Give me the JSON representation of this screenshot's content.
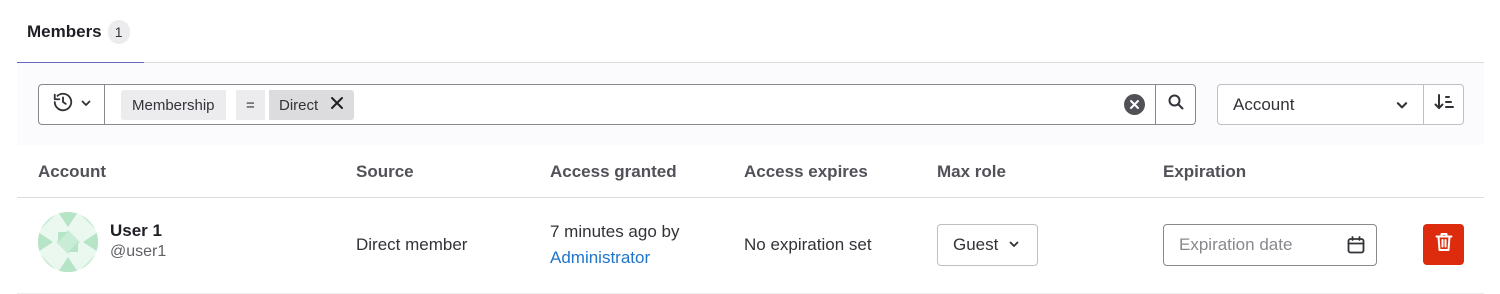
{
  "tabs": [
    {
      "label": "Members",
      "count": "1"
    }
  ],
  "filter": {
    "token_key": "Membership",
    "token_operator": "=",
    "token_value": "Direct"
  },
  "sort": {
    "selected": "Account"
  },
  "table": {
    "headers": [
      "Account",
      "Source",
      "Access granted",
      "Access expires",
      "Max role",
      "Expiration"
    ],
    "rows": [
      {
        "name": "User 1",
        "username": "@user1",
        "source": "Direct member",
        "granted_time": "7 minutes ago by",
        "granted_by": "Administrator",
        "expires": "No expiration set",
        "role": "Guest",
        "expiration_placeholder": "Expiration date"
      }
    ]
  },
  "colors": {
    "accent": "#6666c4",
    "link": "#1f75cb",
    "danger": "#dd2b0e",
    "avatar": "#c9ecd6"
  },
  "icons": [
    "history-icon",
    "chevron-down-icon",
    "close-icon",
    "clear-icon",
    "search-icon",
    "sort-ascending-icon",
    "calendar-icon",
    "trash-icon"
  ]
}
